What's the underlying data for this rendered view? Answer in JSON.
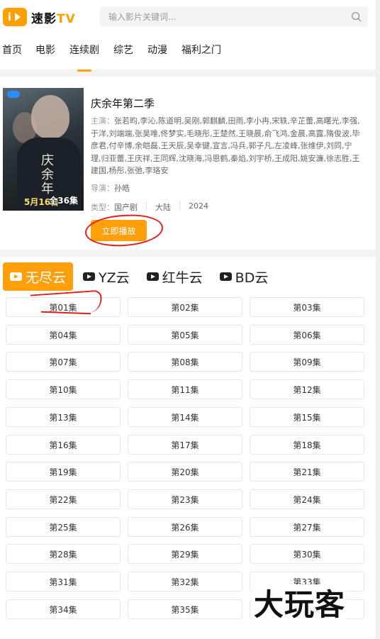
{
  "header": {
    "logo_main": "速影",
    "logo_tv": "TV",
    "search_placeholder": "输入影片关键词..."
  },
  "nav": {
    "items": [
      "首页",
      "电影",
      "连续剧",
      "综艺",
      "动漫",
      "福利之门"
    ],
    "active_index": 2
  },
  "detail": {
    "title": "庆余年第二季",
    "cast_label": "主演：",
    "cast": "张若昀,李沁,陈道明,吴刚,郭麒麟,田雨,李小冉,宋轶,辛芷蕾,高曙光,李强,于洋,刘端端,张昊唯,佟梦实,毛晓彤,王楚然,王晓晨,俞飞鸿,金晨,高露,隋俊波,毕彦君,付辛博,余皑磊,王天辰,吴幸键,宣言,冯兵,郭子凡,左凌峰,张维伊,刘同,宁理,归亚蕾,王庆祥,王同辉,沈晓海,冯恩鹤,秦焰,刘宇桥,王成阳,姚安濂,徐志胜,王建国,杨彤,张弛,李珞安",
    "director_label": "导演：",
    "director": "孙皓",
    "type_label": "类型：",
    "type": "国产剧",
    "region": "大陆",
    "year": "2024",
    "play_button": "立即播放",
    "poster": {
      "title": "庆余年",
      "date": "5月16日",
      "badge": "全36集"
    }
  },
  "sources": [
    {
      "label": "无尽云",
      "icon": "play-icon",
      "active": true
    },
    {
      "label": "YZ云",
      "icon": "play-icon",
      "active": false
    },
    {
      "label": "红牛云",
      "icon": "play-icon",
      "active": false
    },
    {
      "label": "BD云",
      "icon": "play-icon",
      "active": false
    }
  ],
  "episodes": [
    "第01集",
    "第02集",
    "第03集",
    "第04集",
    "第05集",
    "第06集",
    "第07集",
    "第08集",
    "第09集",
    "第10集",
    "第11集",
    "第12集",
    "第13集",
    "第14集",
    "第15集",
    "第16集",
    "第17集",
    "第18集",
    "第19集",
    "第20集",
    "第21集",
    "第22集",
    "第23集",
    "第24集",
    "第25集",
    "第26集",
    "第27集",
    "第28集",
    "第29集",
    "第30集",
    "第31集",
    "第32集",
    "第33集",
    "第34集",
    "第35集",
    "第36集"
  ],
  "watermark": "大玩客",
  "colors": {
    "accent": "#ff9f0a",
    "annotation_red": "#e0201c"
  }
}
